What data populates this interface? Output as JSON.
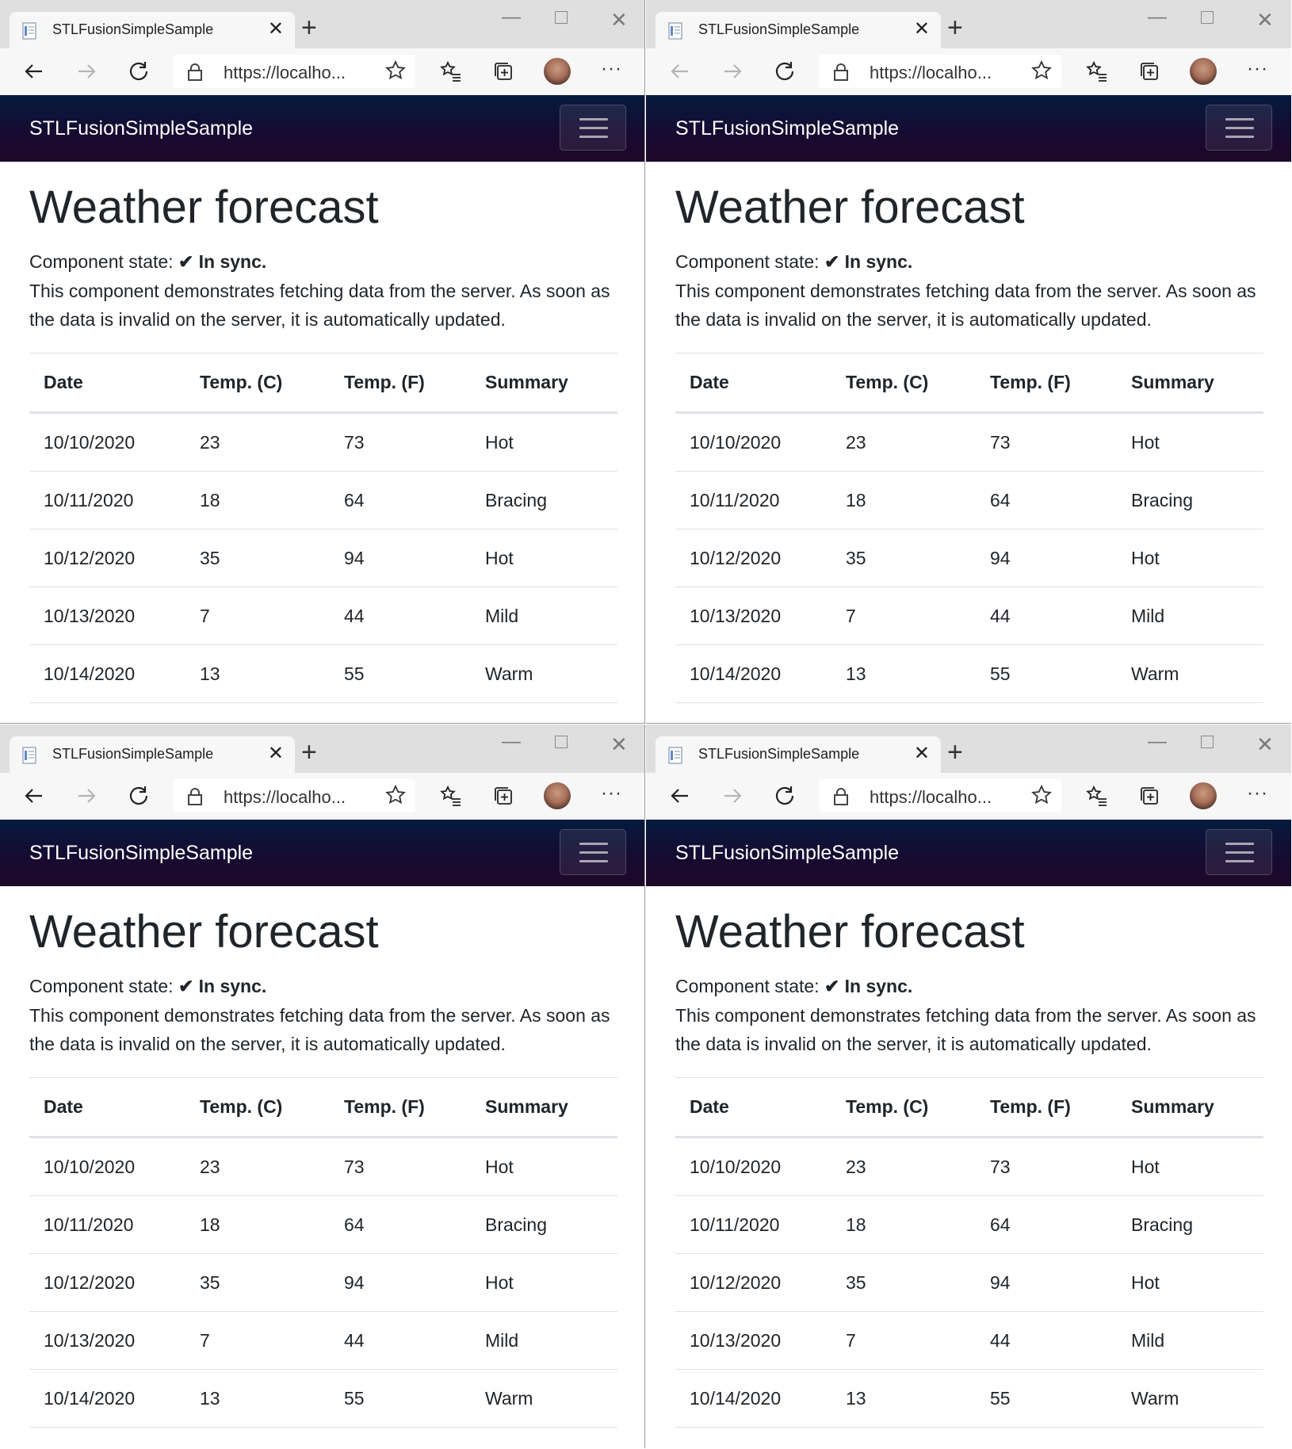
{
  "browser": {
    "tab_title": "STLFusionSimpleSample",
    "tab_close": "✕",
    "new_tab": "+",
    "address": "https://localho...",
    "more": "···"
  },
  "app": {
    "brand": "STLFusionSimpleSample",
    "page_title": "Weather forecast",
    "state_label": "Component state:",
    "state_check": "✔",
    "state_value": "In sync.",
    "description": "This component demonstrates fetching data from the server. As soon as the data is invalid on the server, it is automatically updated."
  },
  "table": {
    "headers": [
      "Date",
      "Temp. (C)",
      "Temp. (F)",
      "Summary"
    ],
    "rows": [
      [
        "10/10/2020",
        "23",
        "73",
        "Hot"
      ],
      [
        "10/11/2020",
        "18",
        "64",
        "Bracing"
      ],
      [
        "10/12/2020",
        "35",
        "94",
        "Hot"
      ],
      [
        "10/13/2020",
        "7",
        "44",
        "Mild"
      ],
      [
        "10/14/2020",
        "13",
        "55",
        "Warm"
      ]
    ]
  },
  "windows": [
    {
      "back_enabled": true
    },
    {
      "back_enabled": false
    },
    {
      "back_enabled": true
    },
    {
      "back_enabled": true
    }
  ],
  "colors": {
    "navbar_top": "#061a3e",
    "navbar_bottom": "#1e0828",
    "text": "#212529"
  }
}
